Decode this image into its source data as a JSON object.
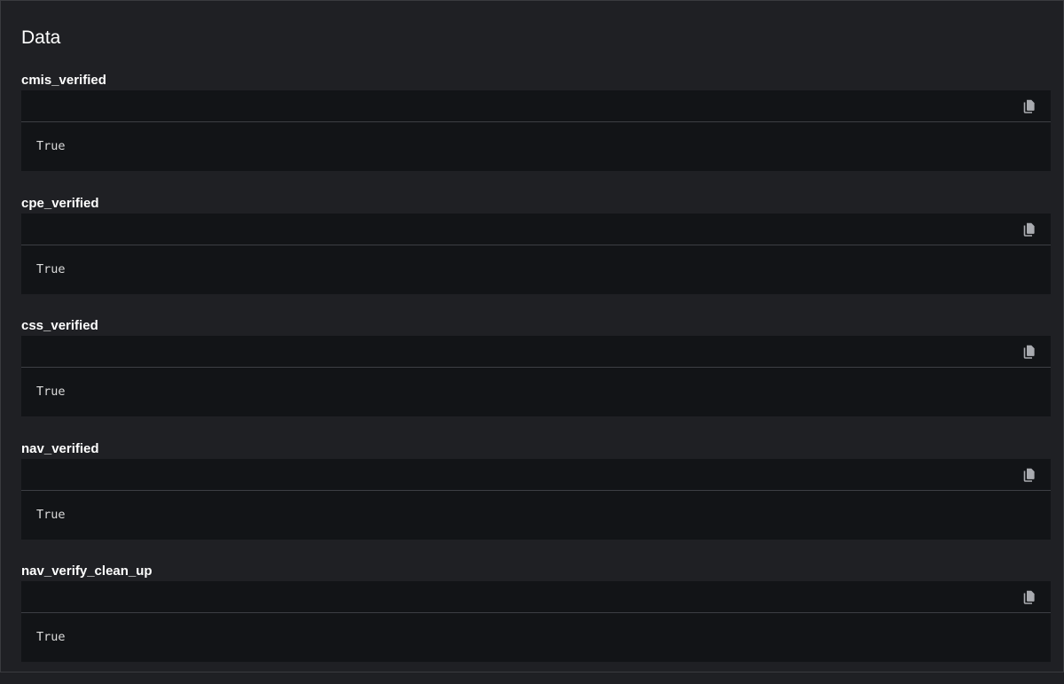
{
  "panel": {
    "title": "Data"
  },
  "entries": [
    {
      "label": "cmis_verified",
      "value": "True",
      "copy_icon": "copy-icon"
    },
    {
      "label": "cpe_verified",
      "value": "True",
      "copy_icon": "copy-icon"
    },
    {
      "label": "css_verified",
      "value": "True",
      "copy_icon": "copy-icon"
    },
    {
      "label": "nav_verified",
      "value": "True",
      "copy_icon": "copy-icon"
    },
    {
      "label": "nav_verify_clean_up",
      "value": "True",
      "copy_icon": "copy-icon"
    }
  ],
  "colors": {
    "panel_background": "#1f2024",
    "code_background": "#121417",
    "text": "#ffffff",
    "code_text": "#dcdcdc",
    "icon": "#a9abb0"
  }
}
